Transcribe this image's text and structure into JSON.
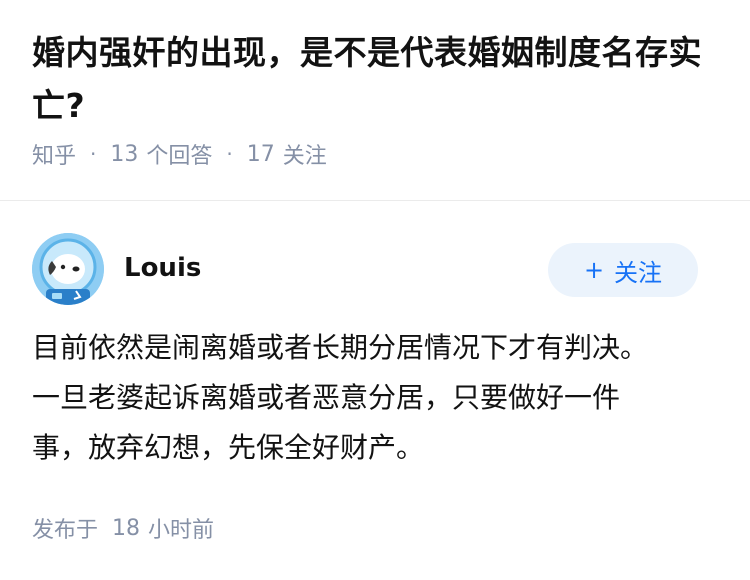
{
  "question": {
    "title": "婚内强奸的出现，是不是代表婚姻制度名存实亡?",
    "source": "知乎",
    "answer_count": "13",
    "answer_label": "个回答",
    "follower_count": "17",
    "follower_label": "关注"
  },
  "answer": {
    "author": {
      "name": "Louis",
      "avatar_icon": "astronaut-dog-avatar-icon"
    },
    "follow_button": {
      "icon": "plus-icon",
      "label": "关注"
    },
    "paragraphs": [
      "目前依然是闹离婚或者长期分居情况下才有判决。",
      "一旦老婆起诉离婚或者恶意分居，只要做好一件事，放弃幻想，先保全好财产。"
    ],
    "footer": {
      "prefix": "发布于",
      "time_value": "18",
      "time_unit": "小时前"
    }
  },
  "colors": {
    "title": "#121212",
    "meta": "#8590a6",
    "accent": "#1772f6",
    "follow_bg": "#ebf3fc",
    "avatar_bg": "#8ecdf3"
  }
}
